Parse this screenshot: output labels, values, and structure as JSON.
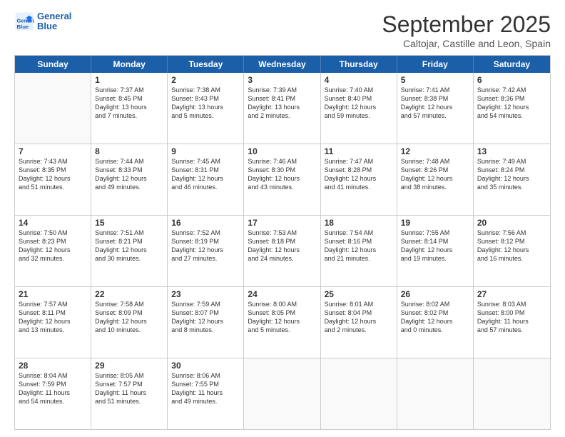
{
  "header": {
    "logo_line1": "General",
    "logo_line2": "Blue",
    "month": "September 2025",
    "location": "Caltojar, Castille and Leon, Spain"
  },
  "days_of_week": [
    "Sunday",
    "Monday",
    "Tuesday",
    "Wednesday",
    "Thursday",
    "Friday",
    "Saturday"
  ],
  "weeks": [
    [
      {
        "day": "",
        "info": ""
      },
      {
        "day": "1",
        "info": "Sunrise: 7:37 AM\nSunset: 8:45 PM\nDaylight: 13 hours\nand 7 minutes."
      },
      {
        "day": "2",
        "info": "Sunrise: 7:38 AM\nSunset: 8:43 PM\nDaylight: 13 hours\nand 5 minutes."
      },
      {
        "day": "3",
        "info": "Sunrise: 7:39 AM\nSunset: 8:41 PM\nDaylight: 13 hours\nand 2 minutes."
      },
      {
        "day": "4",
        "info": "Sunrise: 7:40 AM\nSunset: 8:40 PM\nDaylight: 12 hours\nand 59 minutes."
      },
      {
        "day": "5",
        "info": "Sunrise: 7:41 AM\nSunset: 8:38 PM\nDaylight: 12 hours\nand 57 minutes."
      },
      {
        "day": "6",
        "info": "Sunrise: 7:42 AM\nSunset: 8:36 PM\nDaylight: 12 hours\nand 54 minutes."
      }
    ],
    [
      {
        "day": "7",
        "info": "Sunrise: 7:43 AM\nSunset: 8:35 PM\nDaylight: 12 hours\nand 51 minutes."
      },
      {
        "day": "8",
        "info": "Sunrise: 7:44 AM\nSunset: 8:33 PM\nDaylight: 12 hours\nand 49 minutes."
      },
      {
        "day": "9",
        "info": "Sunrise: 7:45 AM\nSunset: 8:31 PM\nDaylight: 12 hours\nand 46 minutes."
      },
      {
        "day": "10",
        "info": "Sunrise: 7:46 AM\nSunset: 8:30 PM\nDaylight: 12 hours\nand 43 minutes."
      },
      {
        "day": "11",
        "info": "Sunrise: 7:47 AM\nSunset: 8:28 PM\nDaylight: 12 hours\nand 41 minutes."
      },
      {
        "day": "12",
        "info": "Sunrise: 7:48 AM\nSunset: 8:26 PM\nDaylight: 12 hours\nand 38 minutes."
      },
      {
        "day": "13",
        "info": "Sunrise: 7:49 AM\nSunset: 8:24 PM\nDaylight: 12 hours\nand 35 minutes."
      }
    ],
    [
      {
        "day": "14",
        "info": "Sunrise: 7:50 AM\nSunset: 8:23 PM\nDaylight: 12 hours\nand 32 minutes."
      },
      {
        "day": "15",
        "info": "Sunrise: 7:51 AM\nSunset: 8:21 PM\nDaylight: 12 hours\nand 30 minutes."
      },
      {
        "day": "16",
        "info": "Sunrise: 7:52 AM\nSunset: 8:19 PM\nDaylight: 12 hours\nand 27 minutes."
      },
      {
        "day": "17",
        "info": "Sunrise: 7:53 AM\nSunset: 8:18 PM\nDaylight: 12 hours\nand 24 minutes."
      },
      {
        "day": "18",
        "info": "Sunrise: 7:54 AM\nSunset: 8:16 PM\nDaylight: 12 hours\nand 21 minutes."
      },
      {
        "day": "19",
        "info": "Sunrise: 7:55 AM\nSunset: 8:14 PM\nDaylight: 12 hours\nand 19 minutes."
      },
      {
        "day": "20",
        "info": "Sunrise: 7:56 AM\nSunset: 8:12 PM\nDaylight: 12 hours\nand 16 minutes."
      }
    ],
    [
      {
        "day": "21",
        "info": "Sunrise: 7:57 AM\nSunset: 8:11 PM\nDaylight: 12 hours\nand 13 minutes."
      },
      {
        "day": "22",
        "info": "Sunrise: 7:58 AM\nSunset: 8:09 PM\nDaylight: 12 hours\nand 10 minutes."
      },
      {
        "day": "23",
        "info": "Sunrise: 7:59 AM\nSunset: 8:07 PM\nDaylight: 12 hours\nand 8 minutes."
      },
      {
        "day": "24",
        "info": "Sunrise: 8:00 AM\nSunset: 8:05 PM\nDaylight: 12 hours\nand 5 minutes."
      },
      {
        "day": "25",
        "info": "Sunrise: 8:01 AM\nSunset: 8:04 PM\nDaylight: 12 hours\nand 2 minutes."
      },
      {
        "day": "26",
        "info": "Sunrise: 8:02 AM\nSunset: 8:02 PM\nDaylight: 12 hours\nand 0 minutes."
      },
      {
        "day": "27",
        "info": "Sunrise: 8:03 AM\nSunset: 8:00 PM\nDaylight: 11 hours\nand 57 minutes."
      }
    ],
    [
      {
        "day": "28",
        "info": "Sunrise: 8:04 AM\nSunset: 7:59 PM\nDaylight: 11 hours\nand 54 minutes."
      },
      {
        "day": "29",
        "info": "Sunrise: 8:05 AM\nSunset: 7:57 PM\nDaylight: 11 hours\nand 51 minutes."
      },
      {
        "day": "30",
        "info": "Sunrise: 8:06 AM\nSunset: 7:55 PM\nDaylight: 11 hours\nand 49 minutes."
      },
      {
        "day": "",
        "info": ""
      },
      {
        "day": "",
        "info": ""
      },
      {
        "day": "",
        "info": ""
      },
      {
        "day": "",
        "info": ""
      }
    ]
  ]
}
